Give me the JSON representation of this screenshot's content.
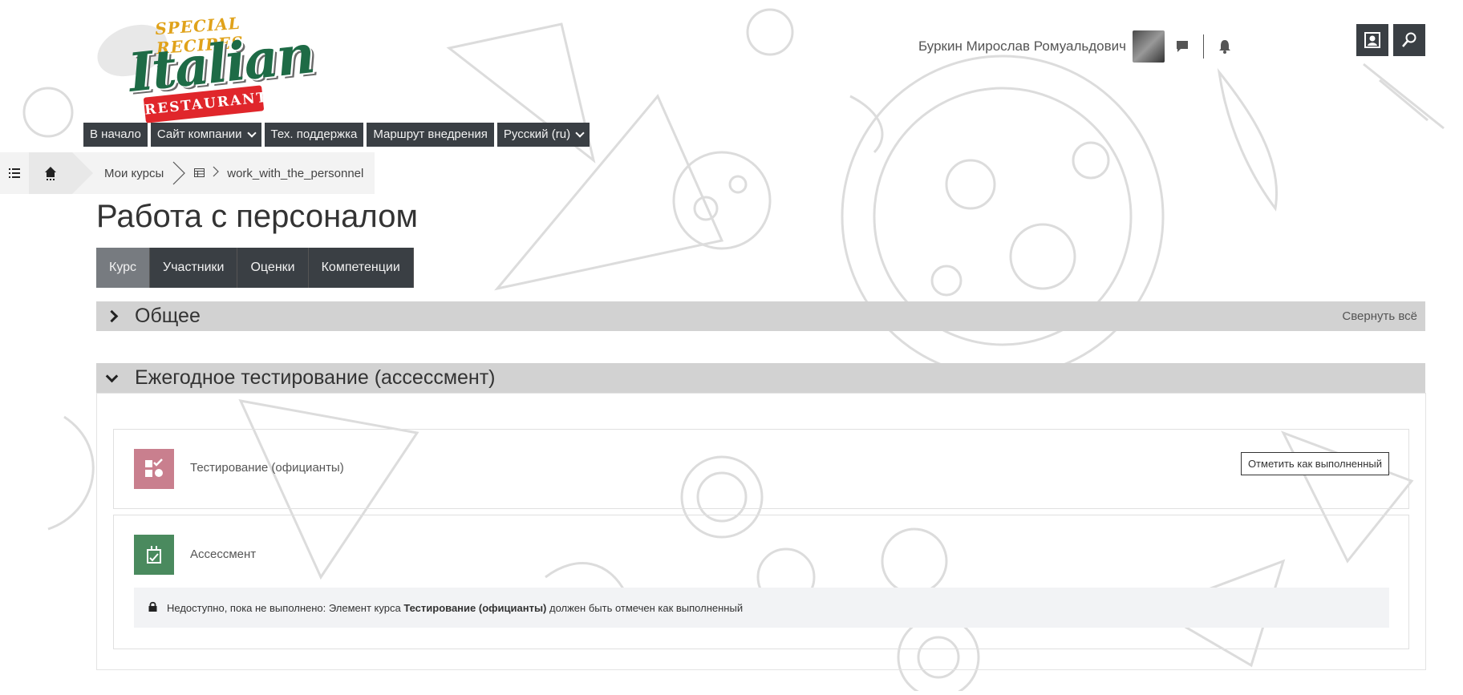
{
  "logo": {
    "top_text": "SPECIAL RECIPES",
    "main_text": "Italian",
    "ribbon_text": "RESTAURANT"
  },
  "header": {
    "user_name": "Буркин Мирослав Ромуальдович",
    "icons": [
      "avatar",
      "message-icon",
      "bell-icon",
      "user-switch-icon",
      "search-icon"
    ]
  },
  "nav": {
    "items": [
      {
        "label": "В начало",
        "dropdown": false
      },
      {
        "label": "Сайт компании",
        "dropdown": true
      },
      {
        "label": "Тех. поддержка",
        "dropdown": false
      },
      {
        "label": "Маршрут внедрения",
        "dropdown": false
      },
      {
        "label": "Русский (ru)",
        "dropdown": true
      }
    ]
  },
  "breadcrumb": {
    "my_courses": "Мои курсы",
    "course_short": "work_with_the_personnel"
  },
  "page": {
    "title": "Работа с персоналом"
  },
  "tabs": [
    {
      "label": "Курс",
      "active": true
    },
    {
      "label": "Участники",
      "active": false
    },
    {
      "label": "Оценки",
      "active": false
    },
    {
      "label": "Компетенции",
      "active": false
    }
  ],
  "sections": {
    "general": {
      "title": "Общее",
      "collapse_all": "Свернуть всё"
    },
    "annual": {
      "title": "Ежегодное тестирование (ассессмент)",
      "activities": [
        {
          "name": "Тестирование (официанты)",
          "icon_color": "#c97f8e",
          "button": "Отметить как выполненный"
        },
        {
          "name": "Ассессмент",
          "icon_color": "#4a8a5e"
        }
      ],
      "restriction": {
        "prefix": "Недоступно, пока не выполнено: Элемент курса",
        "item": "Тестирование (официанты)",
        "suffix": "должен быть отмечен как выполненный"
      }
    }
  },
  "colors": {
    "dark_button": "#3a3f44",
    "active_tab": "#777b80",
    "section_header": "#d2d2d2",
    "logo_green": "#1e6b46",
    "logo_red": "#e0262b",
    "logo_gold": "#e0a21a"
  }
}
